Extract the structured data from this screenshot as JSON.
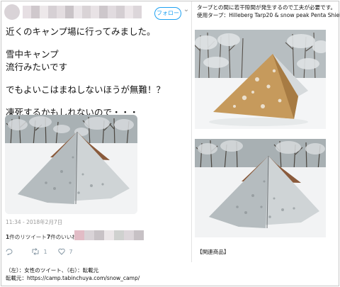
{
  "tweet": {
    "follow_label": "フォローする",
    "text_lines": [
      "近くのキャンプ場に行ってみました。",
      "",
      "雪中キャンプ",
      "流行みたいです",
      "",
      "でもよいこはまねしないほうが無難！？",
      "",
      "凍死するかもしれないので・・・"
    ],
    "timestamp": "11:34 - 2018年2月7日",
    "retweets_count": "1",
    "retweets_label": "件のリツイート",
    "likes_count": "7",
    "likes_label": "件のいいね",
    "actions": {
      "reply_count": "",
      "retweet_count": "1",
      "like_count": "7"
    },
    "colors": {
      "accent": "#1da1f2",
      "muted": "#8899a6"
    },
    "icons": {
      "reply": "reply-icon",
      "retweet": "retweet-icon",
      "like": "heart-icon",
      "menu": "chevron-down-icon"
    }
  },
  "caption": {
    "line1": "（左）：女性のツイート、（右）：転載元",
    "line2": "転載元：https://camp.tabinchuya.com/snow_camp/"
  },
  "right": {
    "line1": "タープとの間に若干隙間が発生するので工夫が必要です。",
    "line2": "使用タープ：Hilleberg Tarp20 & snow peak Penta Shield",
    "related_label": "【関連商品】"
  }
}
